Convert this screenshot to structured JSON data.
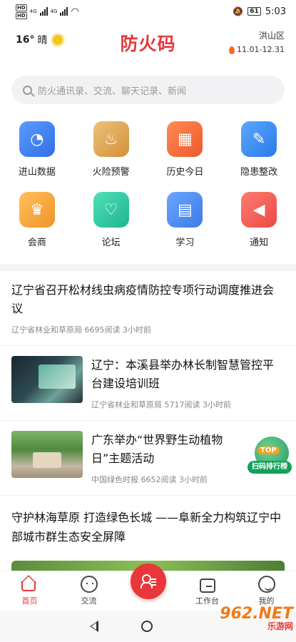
{
  "status_bar": {
    "network_labels": [
      "HD",
      "HD"
    ],
    "signal_labels": [
      "4G",
      "4G"
    ],
    "battery": "61",
    "time": "5:03"
  },
  "header": {
    "temperature": "16°",
    "weather": "晴",
    "title": "防火码",
    "location": "洪山区",
    "date_range": "11.01-12.31"
  },
  "search": {
    "placeholder": "防火通讯录、交流、聊天记录、新闻"
  },
  "grid": [
    {
      "label": "进山数据",
      "color": "#3d7ef2",
      "icon": "pie-chart-icon"
    },
    {
      "label": "火险预警",
      "color": "#e0a84a",
      "icon": "flame-icon"
    },
    {
      "label": "历史今日",
      "color": "#f06a3b",
      "icon": "calendar-icon"
    },
    {
      "label": "隐患整改",
      "color": "#3a8ef5",
      "icon": "wrench-icon"
    },
    {
      "label": "会商",
      "color": "#f2a53a",
      "icon": "crown-icon"
    },
    {
      "label": "论坛",
      "color": "#2fc6a0",
      "icon": "chat-icon"
    },
    {
      "label": "学习",
      "color": "#4a8cf0",
      "icon": "book-icon"
    },
    {
      "label": "通知",
      "color": "#f05a52",
      "icon": "speaker-icon"
    }
  ],
  "news": [
    {
      "title": "辽宁省召开松材线虫病疫情防控专项行动调度推进会议",
      "source": "辽宁省林业和草原局",
      "reads": "6695阅读",
      "time": "3小时前"
    },
    {
      "title": "辽宁：本溪县举办林长制智慧管控平台建设培训班",
      "source": "辽宁省林业和草原局",
      "reads": "5717阅读",
      "time": "3小时前"
    },
    {
      "title": "广东举办“世界野生动植物日”主题活动",
      "source": "中国绿色时报",
      "reads": "6652阅读",
      "time": "3小时前"
    },
    {
      "title": "守护林海草原 打造绿色长城 ——阜新全力构筑辽宁中部城市群生态安全屏障"
    }
  ],
  "badge": {
    "top": "TOP",
    "ribbon": "扫码排行榜"
  },
  "tabbar": [
    {
      "label": "首页",
      "active": true
    },
    {
      "label": "交流"
    },
    {
      "label": "工作台"
    },
    {
      "label": "我的"
    }
  ],
  "watermark": {
    "brand": "962.NET",
    "sub": "乐游网"
  }
}
